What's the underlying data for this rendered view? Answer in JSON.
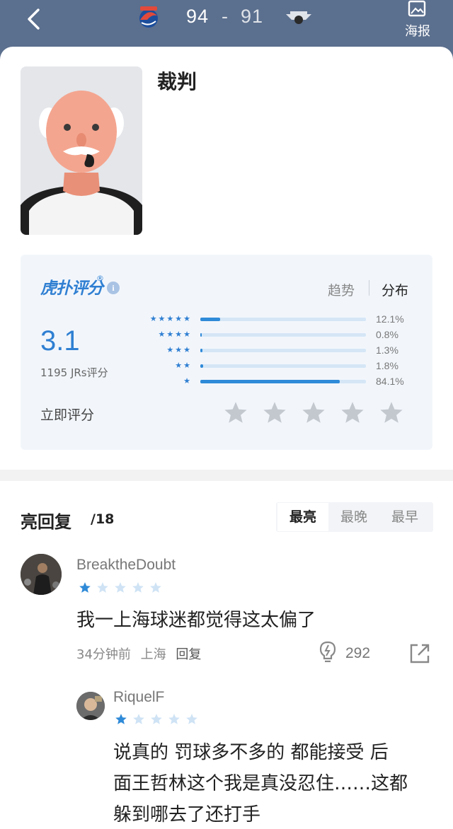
{
  "header": {
    "home_score": "94",
    "separator": "-",
    "away_score": "91",
    "home_logo_icon": "sharks-logo-icon",
    "away_logo_icon": "ducks-logo-icon",
    "poster_label": "海报"
  },
  "profile": {
    "title": "裁判",
    "avatar_icon": "referee-avatar-icon"
  },
  "rating": {
    "brand": "虎扑评分",
    "brand_reg": "®",
    "info": "i",
    "tab_trend": "趋势",
    "tab_distribution": "分布",
    "score": "3.1",
    "count_label": "1195 JRs评分",
    "rate_now": "立即评分",
    "distribution": [
      {
        "stars": "★★★★★",
        "percent_label": "12.1%",
        "value": 12.1
      },
      {
        "stars": "★★★★",
        "percent_label": "0.8%",
        "value": 0.8
      },
      {
        "stars": "★★★",
        "percent_label": "1.3%",
        "value": 1.3
      },
      {
        "stars": "★★",
        "percent_label": "1.8%",
        "value": 1.8
      },
      {
        "stars": "★",
        "percent_label": "84.1%",
        "value": 84.1
      }
    ],
    "accent": "#2f7fd2"
  },
  "comments": {
    "heading": "亮回复",
    "count": "/18",
    "sort_tabs": [
      "最亮",
      "最晚",
      "最早"
    ],
    "items": [
      {
        "user": "BreaktheDoubt",
        "rating": 1,
        "text": "我一上海球迷都觉得这太偏了",
        "time": "34分钟前",
        "location": "上海",
        "reply_label": "回复",
        "lights": "292"
      },
      {
        "user": "RiquelF",
        "rating": 1,
        "text_lines": [
          "说真的 罚球多不多的 都能接受 后",
          "面王哲林这个我是真没忍住……这都",
          "躲到哪去了还打手"
        ]
      }
    ]
  }
}
